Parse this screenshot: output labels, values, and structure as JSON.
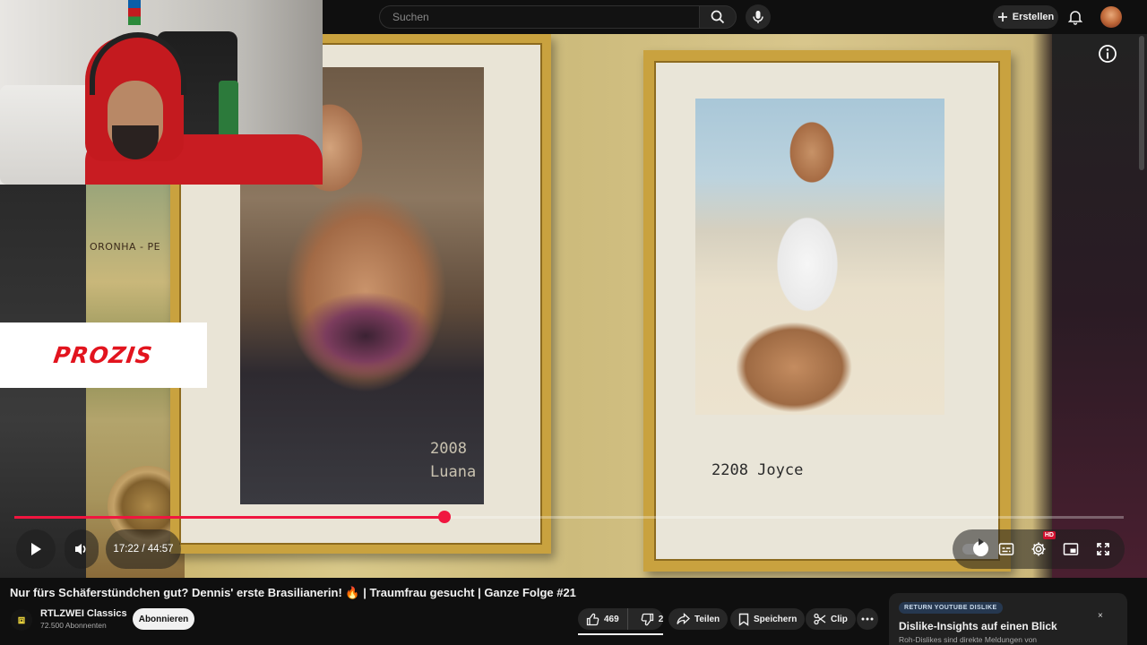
{
  "header": {
    "search_placeholder": "Suchen",
    "create_label": "Erstellen"
  },
  "video": {
    "sponsor_text": "PROZIS",
    "map_text": "ORONHA - PE",
    "frame1_label_line1": "2008",
    "frame1_label_line2": "Luana",
    "frame2_label": "2208 Joyce"
  },
  "player": {
    "time_display": "17:22 / 44:57",
    "progress_fraction": 0.388,
    "hd_badge": "HD"
  },
  "meta": {
    "title": "Nur fürs Schäferstündchen gut? Dennis' erste Brasilianerin! 🔥 | Traumfrau gesucht | Ganze Folge #21",
    "channel_name": "RTLZWEI Classics",
    "subscriber_count": "72.500 Abonnenten",
    "subscribe_label": "Abonnieren",
    "like_count": "469",
    "dislike_count": "2",
    "share_label": "Teilen",
    "save_label": "Speichern",
    "clip_label": "Clip"
  },
  "ryd": {
    "badge": "RETURN YOUTUBE DISLIKE",
    "title": "Dislike-Insights auf einen Blick",
    "subtitle": "Roh-Dislikes sind direkte Meldungen von",
    "close": "×"
  },
  "colors": {
    "accent": "#f0163f",
    "background": "#0f0f0f",
    "sponsor_red": "#e2141e"
  },
  "icons": [
    "search-icon",
    "mic-icon",
    "plus-icon",
    "bell-icon",
    "info-icon",
    "play-icon",
    "volume-icon",
    "autoplay-toggle-icon",
    "subtitles-icon",
    "settings-icon",
    "miniplayer-icon",
    "fullscreen-icon",
    "thumbs-up-icon",
    "thumbs-down-icon",
    "share-icon",
    "bookmark-icon",
    "scissors-icon",
    "more-icon",
    "close-icon"
  ]
}
